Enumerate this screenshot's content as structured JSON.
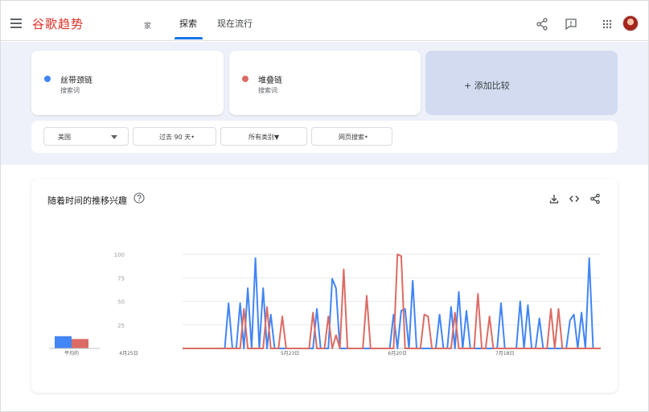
{
  "header": {
    "logo": "谷歌趋势",
    "nav_home": "家",
    "tabs": [
      {
        "label": "探索"
      },
      {
        "label": "现在流行"
      }
    ]
  },
  "terms": [
    {
      "name": "丝带颈链",
      "sub": "搜索词",
      "color": "#4285f4"
    },
    {
      "name": "堆叠链",
      "sub": "搜索词",
      "color": "#db6b64"
    }
  ],
  "add_compare": "+ 添加比较",
  "filters": {
    "region": "美国",
    "time": "过去 90 天•",
    "category": "所有类别▼",
    "search_type": "网页搜索•"
  },
  "chart_section": {
    "title": "随着时间的推移兴趣"
  },
  "chart_data": {
    "type": "line",
    "title": "随着时间的推移兴趣",
    "ylim": [
      0,
      100
    ],
    "yticks": [
      100,
      75,
      50,
      25
    ],
    "x_labels": [
      "4月25日",
      "5月23日",
      "6月20日",
      "7月18日"
    ],
    "x_label_index": [
      0,
      28,
      56,
      84
    ],
    "avg_label": "平均的",
    "averages": [
      13,
      10
    ],
    "series": [
      {
        "name": "丝带颈链",
        "color": "#4285f4",
        "values": [
          0,
          0,
          0,
          0,
          0,
          0,
          0,
          0,
          0,
          0,
          0,
          0,
          0,
          0,
          0,
          0,
          0,
          0,
          0,
          0,
          0,
          0,
          0,
          0,
          0,
          0,
          0,
          0,
          0,
          0,
          0,
          0,
          0,
          0,
          0,
          0,
          0,
          0,
          0,
          0,
          0,
          0,
          0,
          0,
          0,
          0,
          0,
          0,
          0,
          0,
          0,
          0,
          0,
          0,
          0,
          0,
          0,
          0,
          0,
          0,
          0,
          0,
          0,
          0,
          0,
          0,
          0,
          0,
          0,
          0,
          0,
          0,
          0,
          0,
          0,
          0,
          0,
          0,
          0,
          0,
          0,
          0,
          0,
          0,
          0,
          0,
          0,
          0,
          0,
          0
        ]
      },
      {
        "name": "堆叠链",
        "color": "#db6b64",
        "values": [
          0,
          0,
          0,
          0,
          0,
          0,
          0,
          0,
          0,
          0,
          0,
          0,
          0,
          0,
          0,
          0,
          0,
          0,
          0,
          0,
          0,
          0,
          0,
          0,
          0,
          0,
          0,
          0,
          0,
          0,
          0,
          0,
          0,
          0,
          0,
          0,
          0,
          0,
          0,
          0,
          0,
          0,
          0,
          0,
          0,
          0,
          0,
          0,
          0,
          0,
          0,
          0,
          0,
          0,
          0,
          0,
          0,
          0,
          0,
          0,
          0,
          0,
          0,
          0,
          0,
          0,
          0,
          0,
          0,
          0,
          0,
          0,
          0,
          0,
          0,
          0,
          0,
          0,
          0,
          0,
          0,
          0,
          0,
          0,
          0,
          0,
          0,
          0,
          0,
          0
        ]
      }
    ]
  }
}
